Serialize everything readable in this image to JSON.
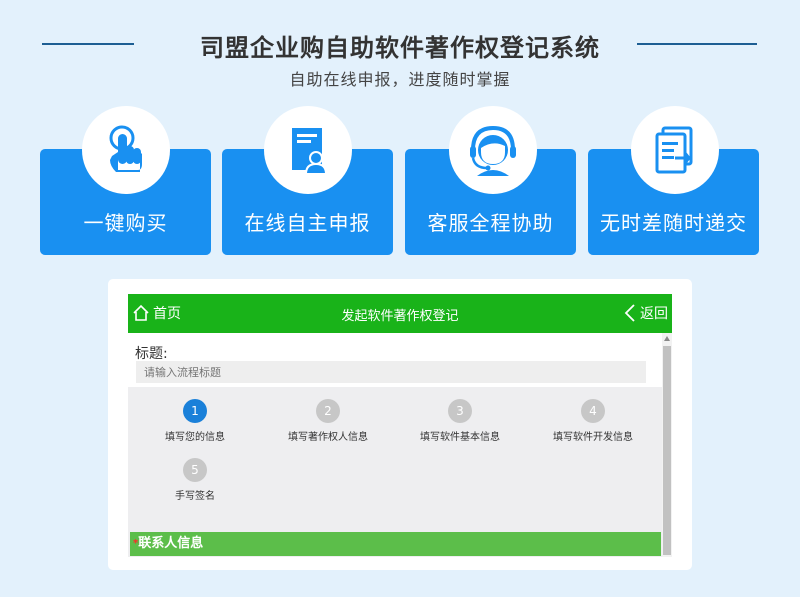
{
  "header": {
    "title": "司盟企业购自助软件著作权登记系统",
    "subtitle": "自助在线申报，进度随时掌握"
  },
  "features": [
    {
      "label": "一键购买",
      "icon": "tap-hand-icon"
    },
    {
      "label": "在线自主申报",
      "icon": "document-user-icon"
    },
    {
      "label": "客服全程协助",
      "icon": "headset-agent-icon"
    },
    {
      "label": "无时差随时递交",
      "icon": "submit-documents-icon"
    }
  ],
  "app": {
    "home_label": "首页",
    "page_title": "发起软件著作权登记",
    "back_label": "返回",
    "form": {
      "title_label": "标题:",
      "title_placeholder": "请输入流程标题"
    },
    "steps": [
      {
        "num": "1",
        "label": "填写您的信息",
        "active": true
      },
      {
        "num": "2",
        "label": "填写著作权人信息",
        "active": false
      },
      {
        "num": "3",
        "label": "填写软件基本信息",
        "active": false
      },
      {
        "num": "4",
        "label": "填写软件开发信息",
        "active": false
      },
      {
        "num": "5",
        "label": "手写签名",
        "active": false
      }
    ],
    "section_required_mark": "*",
    "section_title": "联系人信息"
  },
  "colors": {
    "background": "#e3f1fc",
    "card_blue": "#1990f1",
    "bar_green": "#19b319",
    "section_green": "#5cbe4a",
    "active_step": "#1a80d9"
  }
}
